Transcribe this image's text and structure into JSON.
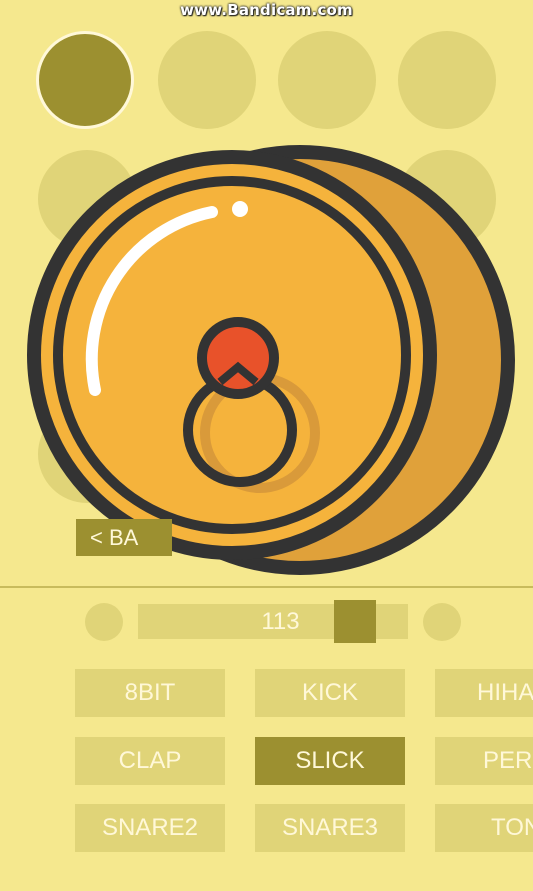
{
  "overlay": {
    "watermark": "www.Bandicam.com"
  },
  "back_button": {
    "label": "< BA"
  },
  "tempo": {
    "value": "113",
    "level": 0.76
  },
  "sounds": [
    {
      "label": "8BIT",
      "selected": false
    },
    {
      "label": "KICK",
      "selected": false
    },
    {
      "label": "HIHA",
      "selected": false
    },
    {
      "label": "CLAP",
      "selected": false
    },
    {
      "label": "SLICK",
      "selected": true
    },
    {
      "label": "PER",
      "selected": false
    },
    {
      "label": "SNARE2",
      "selected": false
    },
    {
      "label": "SNARE3",
      "selected": false
    },
    {
      "label": "TON",
      "selected": false
    }
  ],
  "colors": {
    "background": "#f5e88e",
    "pad": "#e0d478",
    "accent": "#9c9030",
    "cymbal": "#f5b33c",
    "outline": "#333333"
  }
}
